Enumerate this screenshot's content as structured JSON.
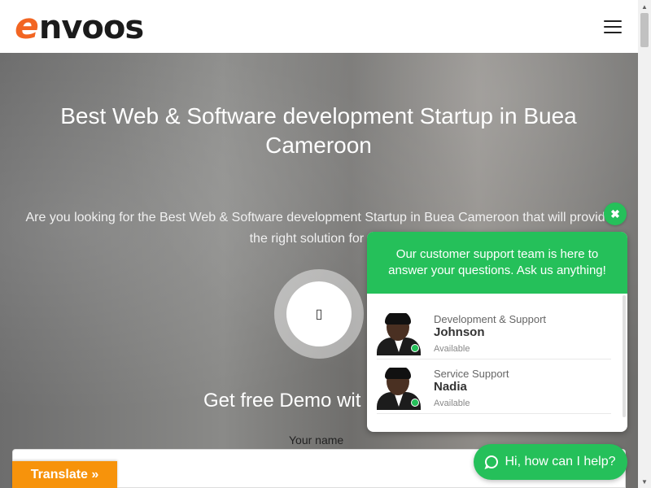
{
  "header": {
    "logo_e": "e",
    "logo_rest": "nvoos"
  },
  "hero": {
    "title": "Best Web & Software development Startup in Buea Cameroon",
    "subtitle": "Are you looking for the Best Web & Software development Startup in Buea Cameroon that will provide the right solution for you",
    "play_glyph": "▯",
    "demo_title": "Get free Demo wit",
    "form": {
      "name_label": "Your name",
      "name_value": ""
    }
  },
  "translate": {
    "label": "Translate »"
  },
  "chat": {
    "close_glyph": "✖",
    "header_text": "Our customer support team is here to answer your questions. Ask us anything!",
    "agents": [
      {
        "role": "Development & Support",
        "name": "Johnson",
        "status": "Available"
      },
      {
        "role": "Service Support",
        "name": "Nadia",
        "status": "Available"
      }
    ],
    "launcher_label": "Hi, how can I help?"
  },
  "colors": {
    "brand_orange": "#f26522",
    "whatsapp_green": "#25c05a",
    "translate_orange": "#f7930b"
  },
  "icons": {
    "menu": "hamburger-menu-icon",
    "play": "play-icon",
    "close": "close-icon",
    "chat": "whatsapp-icon"
  }
}
